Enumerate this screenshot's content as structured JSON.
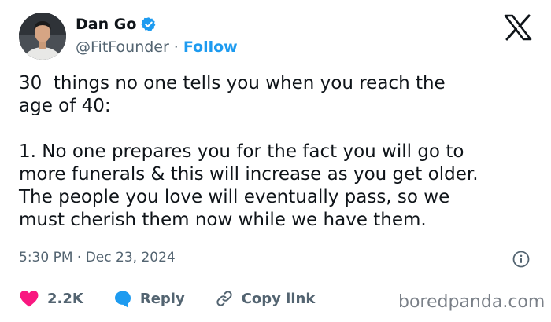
{
  "author": {
    "name": "Dan Go",
    "handle": "@FitFounder",
    "separator": "·",
    "follow_label": "Follow"
  },
  "post": {
    "text": "30  things no one tells you when you reach the\nage of 40:\n\n1. No one prepares you for the fact you will go to\nmore funerals & this will increase as you get older.\nThe people you love will eventually pass, so we\nmust cherish them now while we have them.",
    "timestamp": "5:30 PM · Dec 23, 2024"
  },
  "actions": {
    "like_count": "2.2K",
    "reply_label": "Reply",
    "copy_link_label": "Copy link"
  },
  "watermark": "boredpanda.com",
  "icons": [
    "verified-badge-icon",
    "x-logo-icon",
    "info-icon",
    "heart-icon",
    "reply-bubble-icon",
    "link-icon"
  ],
  "colors": {
    "accent": "#1d9bf0",
    "text": "#0f1419",
    "secondary": "#536471",
    "like": "#f91880",
    "divider": "#cfd9de"
  }
}
